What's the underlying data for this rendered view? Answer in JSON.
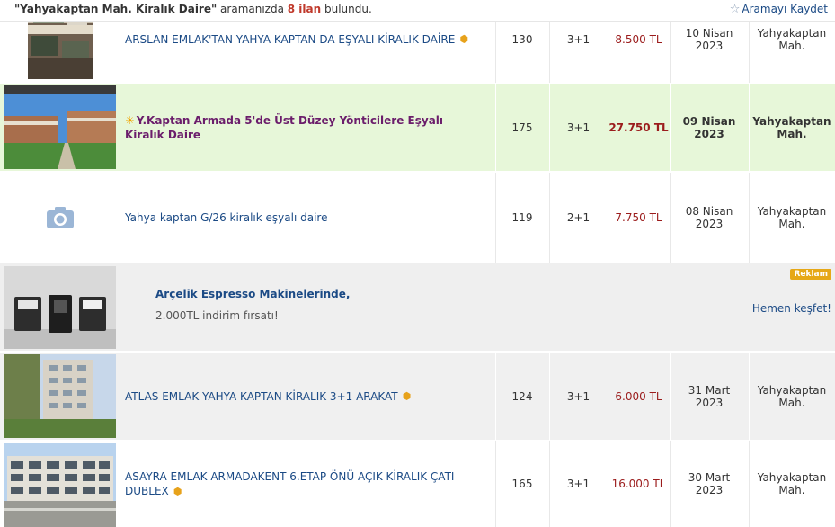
{
  "search_summary": {
    "query": "\"Yahyakaptan Mah. Kiralık Daire\"",
    "middle": " aramanızda ",
    "count": "8 ilan",
    "suffix": " bulundu."
  },
  "save_search": {
    "icon": "star-outline-icon",
    "label": "Aramayı Kaydet"
  },
  "listings": [
    {
      "title": "ARSLAN EMLAK'TAN YAHYA KAPTAN DA EŞYALI KİRALIK DAİRE",
      "m2": "130",
      "rooms": "3+1",
      "price": "8.500 TL",
      "date_day": "10 Nisan",
      "date_year": "2023",
      "loc1": "Yahyakaptan",
      "loc2": "Mah.",
      "has_pin": true,
      "highlight": false
    },
    {
      "title": "Y.Kaptan Armada 5'de Üst Düzey Yöntici̇lere Eşyalı Kiralık Daire",
      "m2": "175",
      "rooms": "3+1",
      "price": "27.750 TL",
      "date_day": "09 Nisan",
      "date_year": "2023",
      "loc1": "Yahyakaptan",
      "loc2": "Mah.",
      "has_pin": false,
      "highlight": true
    },
    {
      "title": "Yahya kaptan G/26 kiralık eşyalı daire",
      "m2": "119",
      "rooms": "2+1",
      "price": "7.750 TL",
      "date_day": "08 Nisan",
      "date_year": "2023",
      "loc1": "Yahyakaptan",
      "loc2": "Mah.",
      "has_pin": false,
      "highlight": false
    },
    {
      "title": "ATLAS EMLAK YAHYA KAPTAN KİRALIK 3+1 ARAKAT",
      "m2": "124",
      "rooms": "3+1",
      "price": "6.000 TL",
      "date_day": "31 Mart",
      "date_year": "2023",
      "loc1": "Yahyakaptan",
      "loc2": "Mah.",
      "has_pin": true,
      "highlight": false
    },
    {
      "title": "ASAYRA EMLAK ARMADAKENT 6.ETAP ÖNÜ AÇIK KİRALIK ÇATI DUBLEX",
      "m2": "165",
      "rooms": "3+1",
      "price": "16.000 TL",
      "date_day": "30 Mart",
      "date_year": "2023",
      "loc1": "Yahyakaptan",
      "loc2": "Mah.",
      "has_pin": true,
      "highlight": false
    }
  ],
  "ad": {
    "title": "Arçelik Espresso Makinelerinde,",
    "subtitle": "2.000TL indirim fırsatı!",
    "badge": "Reklam",
    "link": "Hemen keşfet!"
  },
  "colors": {
    "link_blue": "#1b4a85",
    "price_red": "#9b1c1c",
    "highlight_bg": "#e7f7d9",
    "gray_bg": "#efefef",
    "badge": "#e6a817"
  }
}
